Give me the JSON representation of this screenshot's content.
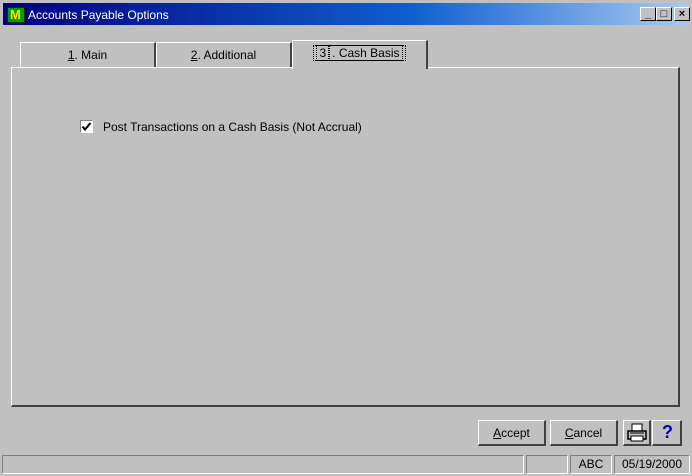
{
  "window": {
    "title": "Accounts Payable Options",
    "app_icon_letter": "M"
  },
  "titlebar_buttons": {
    "minimize": "_",
    "maximize": "□",
    "close": "×"
  },
  "tabs": [
    {
      "hotkey": "1",
      "label": ". Main",
      "active": false
    },
    {
      "hotkey": "2",
      "label": ". Additional",
      "active": false
    },
    {
      "hotkey": "3",
      "label": ". Cash Basis",
      "active": true
    }
  ],
  "cash_basis": {
    "checkbox_label": "Post Transactions on a Cash Basis (Not Accrual)",
    "checked": true
  },
  "buttons": {
    "accept_hotkey": "A",
    "accept_rest": "ccept",
    "cancel_hotkey": "C",
    "cancel_rest": "ancel",
    "help": "?"
  },
  "status_bar": {
    "company": "ABC",
    "date": "05/19/2000"
  },
  "colors": {
    "face": "#c0c0c0",
    "title_start": "#000080",
    "title_end": "#a8caf0",
    "help_blue": "#0000c0"
  }
}
